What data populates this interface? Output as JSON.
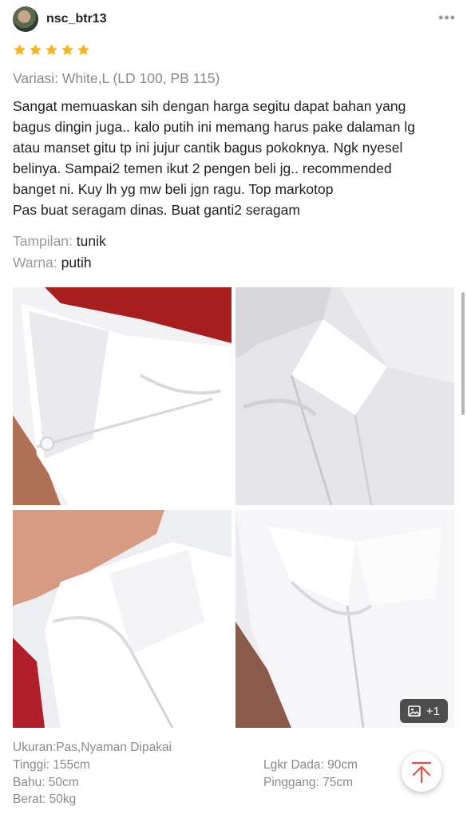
{
  "review": {
    "username": "nsc_btr13",
    "rating": 5,
    "variant": "Variasi: White,L (LD 100, PB 115)",
    "text_lines": [
      "Sangat memuaskan sih dengan harga segitu dapat bahan yang",
      "bagus dingin juga.. kalo putih ini memang harus pake dalaman lg",
      "atau manset gitu tp ini jujur cantik bagus pokoknya. Ngk nyesel",
      "belinya. Sampai2 temen ikut 2 pengen beli jg.. recommended",
      "banget ni. Kuy lh yg mw beli jgn ragu. Top markotop",
      "Pas buat seragam dinas. Buat ganti2 seragam"
    ],
    "attributes": [
      {
        "label": "Tampilan:",
        "value": "tunik"
      },
      {
        "label": "Warna:",
        "value": "putih"
      }
    ],
    "more_photos_count": "+1",
    "specs": {
      "ukuran": "Ukuran:Pas,Nyaman Dipakai",
      "tinggi": "Tinggi: 155cm",
      "bahu": "Bahu: 50cm",
      "berat": "Berat: 50kg",
      "lingkar_dada": "Lgkr Dada: 90cm",
      "pinggang": "Pinggang: 75cm"
    }
  },
  "icons": {
    "star": "star-icon",
    "more": "more-dots-icon",
    "image": "image-icon",
    "back_to_top": "arrow-up-icon"
  },
  "colors": {
    "star": "#F5B51B",
    "back_to_top_arrow": "#E8503A",
    "muted_text": "#8A8A8A"
  }
}
